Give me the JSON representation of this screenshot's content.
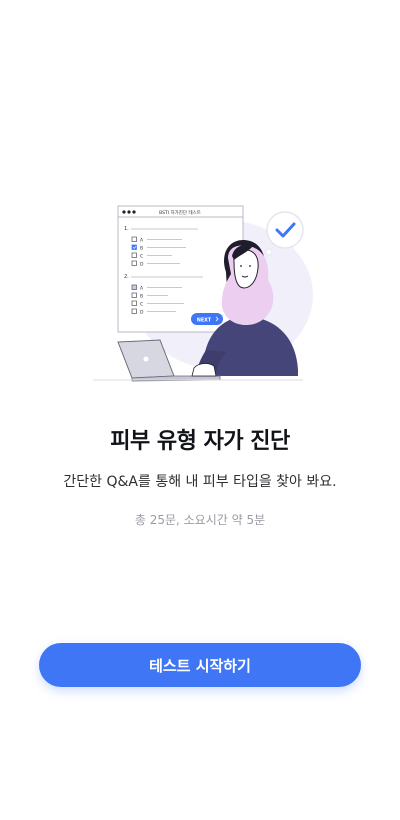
{
  "illustration": {
    "window_title": "BSTI 자가진단 테스트",
    "questions": [
      {
        "number": "1.",
        "options": [
          {
            "label": "A",
            "checked": false
          },
          {
            "label": "B",
            "checked": true
          },
          {
            "label": "C",
            "checked": false
          },
          {
            "label": "D",
            "checked": false
          }
        ]
      },
      {
        "number": "2.",
        "options": [
          {
            "label": "A",
            "checked": true
          },
          {
            "label": "B",
            "checked": false
          },
          {
            "label": "C",
            "checked": false
          },
          {
            "label": "D",
            "checked": false
          }
        ]
      }
    ],
    "next_label": "NEXT",
    "colors": {
      "accent": "#3f76f6",
      "scarf": "#eccff0",
      "sweater": "#46457a",
      "bubble_bg": "#efedf8"
    }
  },
  "content": {
    "title": "피부 유형 자가 진단",
    "subtitle": "간단한 Q&A를 통해 내 피부 타입을 찾아 봐요.",
    "meta": "총 25문, 소요시간 약 5분"
  },
  "actions": {
    "start_label": "테스트 시작하기"
  },
  "colors": {
    "primary_button": "#3f76f6",
    "title_text": "#111318",
    "meta_text": "#9a9ca3"
  }
}
